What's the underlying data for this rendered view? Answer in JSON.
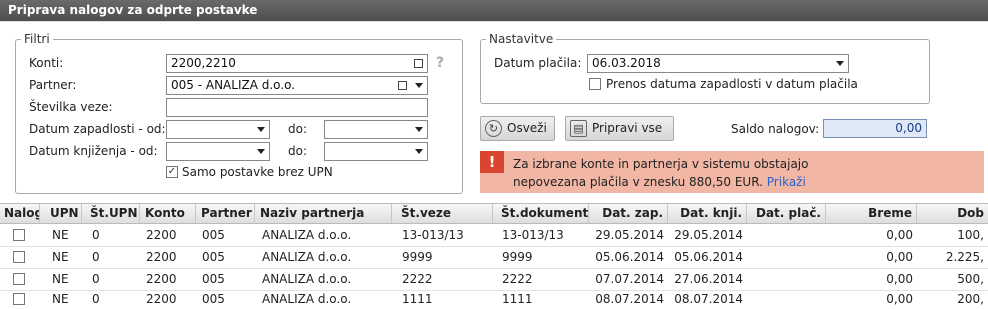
{
  "title": "Priprava nalogov za odprte postavke",
  "filters": {
    "legend": "Filtri",
    "konti_label": "Konti:",
    "konti_value": "2200,2210",
    "partner_label": "Partner:",
    "partner_value": "005 - ANALIZA d.o.o.",
    "stevilka_label": "Številka veze:",
    "stevilka_value": "",
    "zapadlost_label": "Datum zapadlosti - od:",
    "knjizenje_label": "Datum knjiženja - od:",
    "do_label": "do:",
    "samo_label": "Samo postavke brez UPN",
    "samo_checked": true,
    "help": "?"
  },
  "settings": {
    "legend": "Nastavitve",
    "datum_label": "Datum plačila:",
    "datum_value": "06.03.2018",
    "prenos_label": "Prenos datuma zapadlosti v datum plačila",
    "prenos_checked": false
  },
  "actions": {
    "osvezi": "Osveži",
    "pripravi": "Pripravi vse",
    "saldo_label": "Saldo nalogov:",
    "saldo_value": "0,00"
  },
  "warning": {
    "mark": "!",
    "text": "Za izbrane konte in partnerja v sistemu obstajajo nepovezana plačila v znesku 880,50 EUR.",
    "link": "Prikaži"
  },
  "table": {
    "headers": [
      "Nalog",
      "UPN",
      "Št.UPN",
      "Konto",
      "Partner",
      "Naziv partnerja",
      "Št.veze",
      "Št.dokumenta",
      "Dat. zap.",
      "Dat. knji.",
      "Dat. plač.",
      "Breme",
      "Dob"
    ],
    "rows": [
      {
        "upn": "NE",
        "st_upn": "0",
        "konto": "2200",
        "partner": "005",
        "naziv": "ANALIZA d.o.o.",
        "st_veze": "13-013/13",
        "st_dok": "13-013/13",
        "dat_zap": "29.05.2014",
        "dat_knji": "29.05.2014",
        "dat_plac": "",
        "breme": "0,00",
        "dob": "100,"
      },
      {
        "upn": "NE",
        "st_upn": "0",
        "konto": "2200",
        "partner": "005",
        "naziv": "ANALIZA d.o.o.",
        "st_veze": "9999",
        "st_dok": "9999",
        "dat_zap": "05.06.2014",
        "dat_knji": "05.06.2014",
        "dat_plac": "",
        "breme": "0,00",
        "dob": "2.225,"
      },
      {
        "upn": "NE",
        "st_upn": "0",
        "konto": "2200",
        "partner": "005",
        "naziv": "ANALIZA d.o.o.",
        "st_veze": "2222",
        "st_dok": "2222",
        "dat_zap": "07.07.2014",
        "dat_knji": "27.06.2014",
        "dat_plac": "",
        "breme": "0,00",
        "dob": "500,"
      },
      {
        "upn": "NE",
        "st_upn": "0",
        "konto": "2200",
        "partner": "005",
        "naziv": "ANALIZA d.o.o.",
        "st_veze": "1111",
        "st_dok": "1111",
        "dat_zap": "08.07.2014",
        "dat_knji": "08.07.2014",
        "dat_plac": "",
        "breme": "0,00",
        "dob": "200,"
      }
    ]
  }
}
